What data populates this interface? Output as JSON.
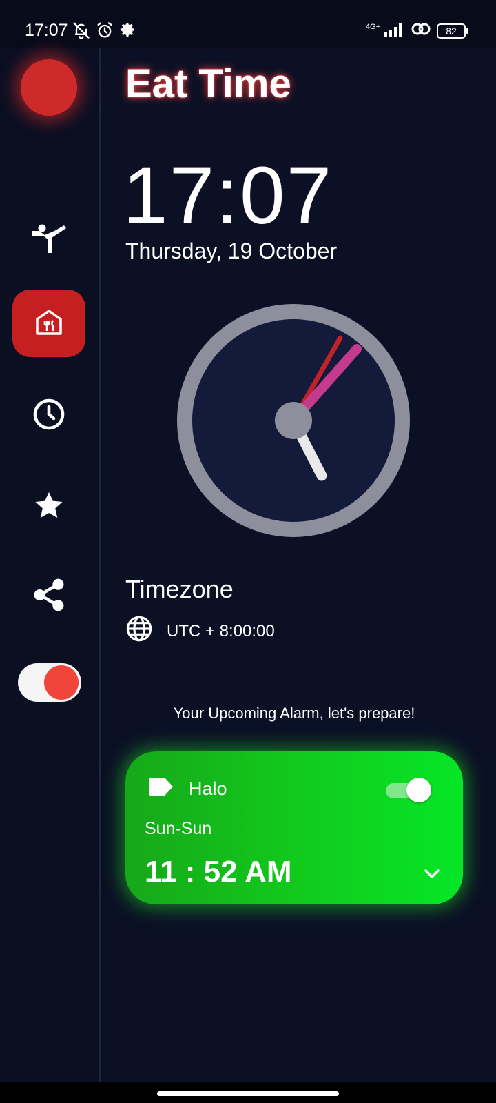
{
  "status_bar": {
    "time": "17:07",
    "network": "4G+",
    "battery": "82",
    "icons_left": [
      "bell-off-icon",
      "alarm-icon",
      "gear-icon"
    ],
    "icons_right": [
      "signal-icon",
      "link-icon",
      "battery-icon"
    ]
  },
  "app": {
    "title": "Eat Time"
  },
  "sidebar": {
    "items": [
      {
        "name": "fitness",
        "icon": "martial-arts-icon"
      },
      {
        "name": "eat",
        "icon": "restaurant-home-icon",
        "active": true
      },
      {
        "name": "clock",
        "icon": "clock-icon"
      },
      {
        "name": "favorites",
        "icon": "star-icon"
      },
      {
        "name": "share",
        "icon": "share-icon"
      }
    ],
    "theme_toggle_on": true
  },
  "clock": {
    "digital": "17:07",
    "date": "Thursday, 19 October",
    "hands": {
      "hour": 17,
      "minute": 7
    },
    "colors": {
      "ring": "#8d8f9c",
      "face": "#131a3a",
      "second": "#c0222a",
      "minute": "#c43a8c",
      "hour": "#e9e9ea"
    }
  },
  "timezone": {
    "title": "Timezone",
    "value": "UTC + 8:00:00",
    "icon": "globe-icon"
  },
  "alarm": {
    "heading": "Your Upcoming Alarm, let's prepare!",
    "label": "Halo",
    "enabled": true,
    "days": "Sun-Sun",
    "time": "11 : 52 AM",
    "accent": "#13c91d"
  }
}
